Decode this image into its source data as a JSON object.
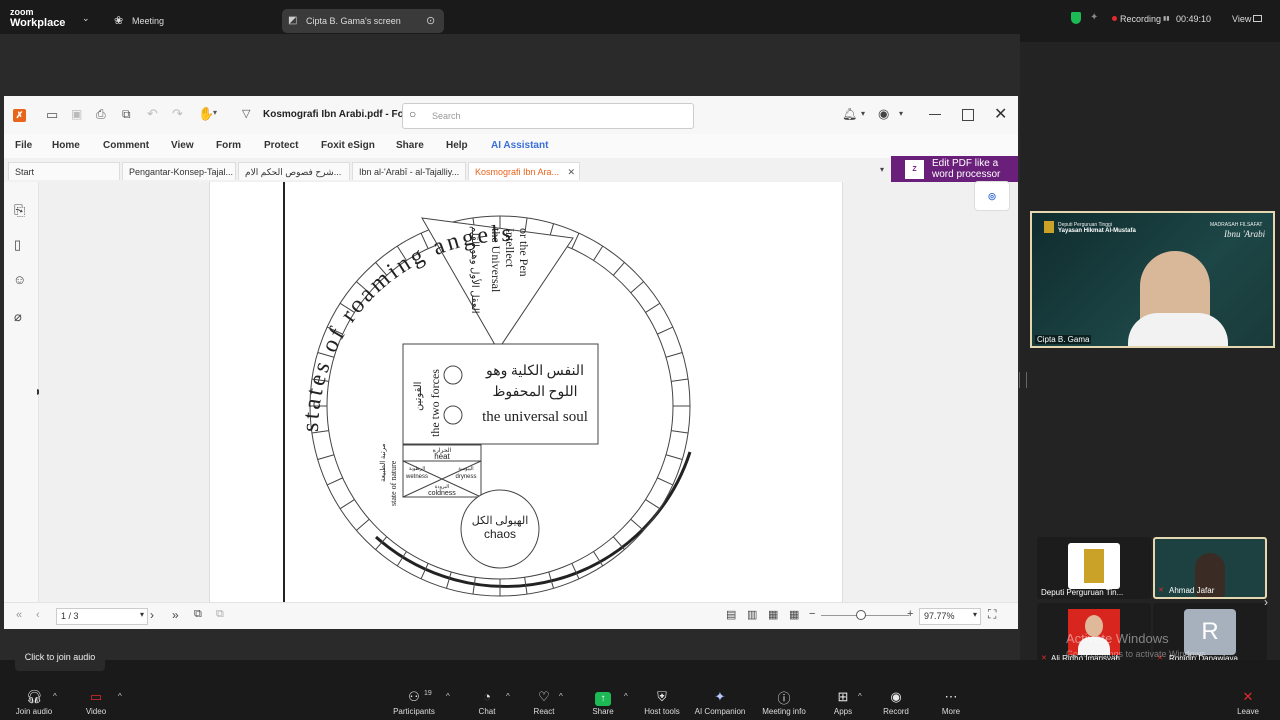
{
  "zoom": {
    "logo_line1": "zoom",
    "logo_line2": "Workplace",
    "meeting_label": "Meeting",
    "share_tab_label": "Cipta B. Gama's screen",
    "recording_label": "Recording",
    "recording_time": "00:49:10",
    "view_label": "View",
    "tooltip_join_audio": "Click to join audio"
  },
  "foxit": {
    "doc_title": "Kosmografi Ibn Arabi.pdf - Fo...",
    "search_placeholder": "Search",
    "menu": [
      "File",
      "Home",
      "Comment",
      "View",
      "Form",
      "Protect",
      "Foxit eSign",
      "Share",
      "Help",
      "AI Assistant"
    ],
    "tabs": [
      "Start",
      "Pengantar-Konsep-Tajal...",
      "شرح فصوص الحكم الام...",
      "Ibn al-'Arabī - al-Tajalliy...",
      "Kosmografi Ibn Ara..."
    ],
    "promo_line1": "Edit PDF like a",
    "promo_line2": "word processor",
    "page_indicator": "1 / 3",
    "zoom_value": "97.77%",
    "diagram": {
      "outer_text": "states of roaming angels",
      "top_arabic": "العقل الأول وهو القلم",
      "intellect_1": "the Universal",
      "intellect_2": "Intellect",
      "intellect_3": "or the Pen",
      "soul_ar1": "النفس الكلية وهو",
      "soul_ar2": "اللوح المحفوظ",
      "soul_en": "the universal soul",
      "forces_en": "the two forces",
      "forces_ar": "القوتين",
      "nature_en": "state of nature",
      "nature_ar": "مرتبة الطبيعة",
      "heat_ar": "الحرارة",
      "heat": "heat",
      "wetness_ar": "الرطوبة",
      "wetness": "wetness",
      "dryness_ar": "اليبوسة",
      "dryness": "dryness",
      "coldness_ar": "البرودة",
      "coldness": "coldness",
      "chaos_ar": "الهيولى الكل",
      "chaos": "chaos"
    }
  },
  "participants_panel": {
    "main_name": "Cipta B. Gama",
    "main_banner_1": "Deputi Perguruan Tinggi",
    "main_banner_2": "Yayasan Hikmat Al-Mustafa",
    "main_banner_3": "MADRASAH FILSAFAT",
    "main_banner_4": "Ibnu 'Arabi",
    "tiles": [
      {
        "name": "Deputi Perguruan Tin..."
      },
      {
        "name": "Ahmad Jafar"
      },
      {
        "name": "Ali Ridho Imansyah"
      },
      {
        "name": "Ronidin Danawjaya",
        "initial": "R"
      }
    ],
    "watermark_1": "Activate Windows",
    "watermark_2": "Go to Settings to activate Windows."
  },
  "toolbar": {
    "items": [
      {
        "label": "Join audio"
      },
      {
        "label": "Video"
      },
      {
        "label": "Participants",
        "count": "19"
      },
      {
        "label": "Chat"
      },
      {
        "label": "React"
      },
      {
        "label": "Share"
      },
      {
        "label": "Host tools"
      },
      {
        "label": "AI Companion"
      },
      {
        "label": "Meeting info"
      },
      {
        "label": "Apps"
      },
      {
        "label": "Record"
      },
      {
        "label": "More"
      },
      {
        "label": "Leave"
      }
    ]
  },
  "colors": {
    "accent_green": "#1db954",
    "record_red": "#e02b2b",
    "promo_purple": "#6a1f7a",
    "foxit_orange": "#e8641b",
    "ai_blue": "#3a6fd8"
  }
}
